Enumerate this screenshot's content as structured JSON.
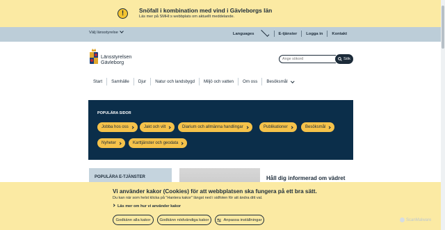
{
  "alert": {
    "icon": "exclamation-icon",
    "title": "Snöfall i kombination med vind i Gävleborgs län",
    "text": "Läs mer på SMHI:s webbplats om aktuellt meddelande."
  },
  "topnav": {
    "county_select": "Välj länsstyrelse",
    "languages": "Languages",
    "e_services": "E-tjänster",
    "login": "Logga in",
    "contact": "Kontakt"
  },
  "header": {
    "logo_line1": "Länsstyrelsen",
    "logo_line2": "Gävleborg",
    "search_placeholder": "Ange sökord",
    "search_button": "Sök"
  },
  "mainnav": {
    "items": [
      "Start",
      "Samhälle",
      "Djur",
      "Natur och landsbygd",
      "Miljö och vatten",
      "Om oss",
      "Besöksmål"
    ]
  },
  "popular": {
    "title": "POPULÄRA SIDOR",
    "chips": [
      "Jobba hos oss",
      "Jakt och vilt",
      "Diarium och allmänna handlingar",
      "Publikationer",
      "Besöksmål",
      "Nyheter",
      "Karttjänster och geodata"
    ]
  },
  "etjanster": {
    "title": "POPULÄRA E-TJÄNSTER"
  },
  "news": {
    "title": "Håll dig informerad om vädret"
  },
  "cookie": {
    "title": "Vi använder kakor (Cookies) för att webbplatsen ska fungera på ett bra sätt.",
    "text": "Du kan när som helst klicka på \"Hantera kakor\" längst ned i sidfoten för att ändra ditt val.",
    "link": "Läs mer om hur vi använder kakor",
    "btn_all": "Godkänn alla kakor",
    "btn_necessary": "Godkänn nödvändiga kakor",
    "btn_adjust": "Anpassa inställningar"
  },
  "watermark": "ScanMalware",
  "colors": {
    "alert_bg": "#fbeaa3",
    "topnav_bg": "#bccdd8",
    "dark_blue": "#0b2e4a",
    "chip_yellow": "#f5c24a",
    "text": "#1c2b39"
  }
}
